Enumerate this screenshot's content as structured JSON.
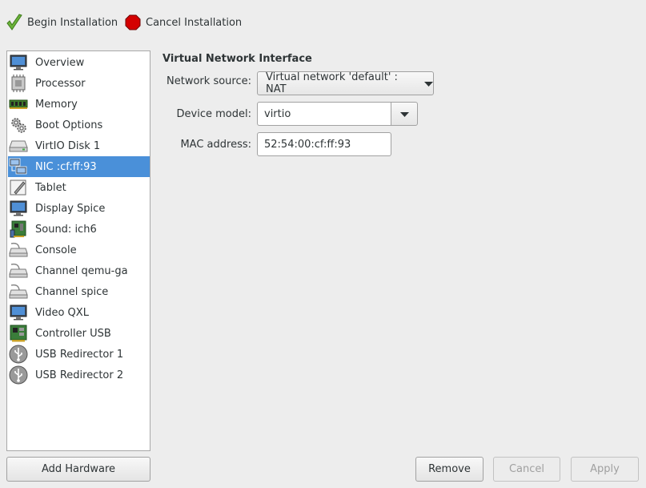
{
  "toolbar": {
    "begin_label": "Begin Installation",
    "cancel_label": "Cancel Installation"
  },
  "hardware_list": [
    {
      "label": "Overview",
      "icon": "monitor-icon"
    },
    {
      "label": "Processor",
      "icon": "cpu-icon"
    },
    {
      "label": "Memory",
      "icon": "memory-icon"
    },
    {
      "label": "Boot Options",
      "icon": "gears-icon"
    },
    {
      "label": "VirtIO Disk 1",
      "icon": "disk-icon"
    },
    {
      "label": "NIC :cf:ff:93",
      "icon": "network-icon",
      "selected": true
    },
    {
      "label": "Tablet",
      "icon": "tablet-icon"
    },
    {
      "label": "Display Spice",
      "icon": "monitor-icon"
    },
    {
      "label": "Sound: ich6",
      "icon": "sound-card-icon"
    },
    {
      "label": "Console",
      "icon": "serial-icon"
    },
    {
      "label": "Channel qemu-ga",
      "icon": "serial-icon"
    },
    {
      "label": "Channel spice",
      "icon": "serial-icon"
    },
    {
      "label": "Video QXL",
      "icon": "monitor-icon"
    },
    {
      "label": "Controller USB",
      "icon": "controller-card-icon"
    },
    {
      "label": "USB Redirector 1",
      "icon": "usb-icon"
    },
    {
      "label": "USB Redirector 2",
      "icon": "usb-icon"
    }
  ],
  "details": {
    "section_title": "Virtual Network Interface",
    "network_source_label": "Network source:",
    "network_source_value": "Virtual network 'default' : NAT",
    "device_model_label": "Device model:",
    "device_model_value": "virtio",
    "mac_label": "MAC address:",
    "mac_value": "52:54:00:cf:ff:93"
  },
  "buttons": {
    "add_hardware": "Add Hardware",
    "remove": "Remove",
    "cancel": "Cancel",
    "apply": "Apply"
  },
  "colors": {
    "selection": "#4a90d9",
    "window_bg": "#ededed"
  }
}
